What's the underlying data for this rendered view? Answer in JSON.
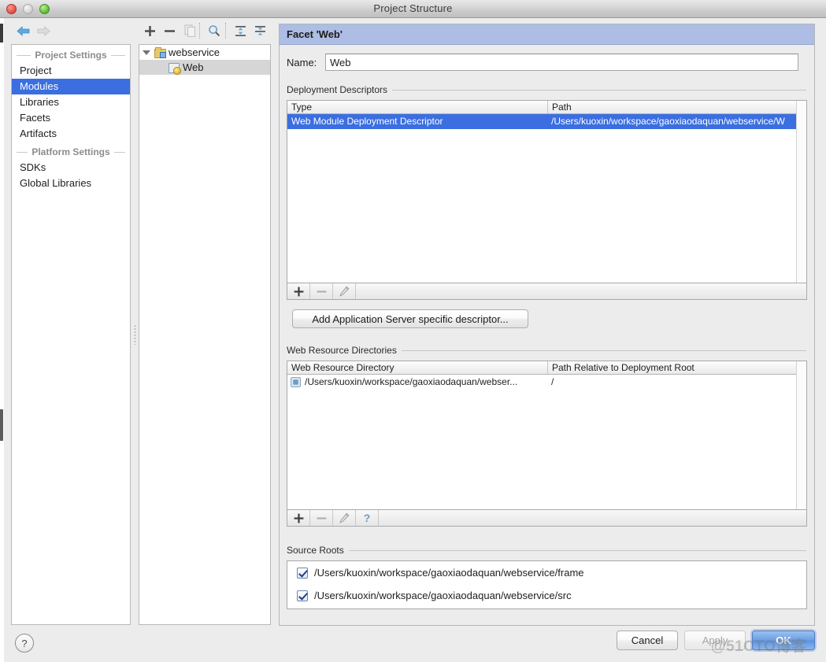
{
  "window": {
    "title": "Project Structure",
    "controls": [
      "close",
      "minimize",
      "zoom"
    ]
  },
  "toolbar": {
    "back_icon": "arrow-left-icon",
    "forward_icon": "arrow-right-icon",
    "add_label": "+",
    "remove_label": "−",
    "copy_icon": "copy-icon",
    "find_icon": "search-icon",
    "expand_all_icon": "expand-all-icon",
    "collapse_all_icon": "collapse-all-icon"
  },
  "sidebar": {
    "groups": [
      {
        "title": "Project Settings",
        "items": [
          {
            "label": "Project",
            "selected": false
          },
          {
            "label": "Modules",
            "selected": true
          },
          {
            "label": "Libraries",
            "selected": false
          },
          {
            "label": "Facets",
            "selected": false
          },
          {
            "label": "Artifacts",
            "selected": false
          }
        ]
      },
      {
        "title": "Platform Settings",
        "items": [
          {
            "label": "SDKs",
            "selected": false
          },
          {
            "label": "Global Libraries",
            "selected": false
          }
        ]
      }
    ]
  },
  "tree": {
    "items": [
      {
        "label": "webservice",
        "icon": "module-folder-icon",
        "level": 0,
        "expanded": true,
        "selected": false
      },
      {
        "label": "Web",
        "icon": "web-facet-icon",
        "level": 1,
        "expanded": false,
        "selected": true
      }
    ]
  },
  "detail": {
    "facet_title": "Facet 'Web'",
    "name": {
      "label": "Name:",
      "value": "Web",
      "placeholder": ""
    },
    "deployment_descriptors": {
      "section_title": "Deployment Descriptors",
      "columns": [
        "Type",
        "Path"
      ],
      "rows": [
        {
          "type": "Web Module Deployment Descriptor",
          "path": "/Users/kuoxin/workspace/gaoxiaodaquan/webservice/W",
          "selected": true
        }
      ],
      "toolbar": [
        "+",
        "−",
        "edit-icon"
      ],
      "add_server_descriptor_label": "Add Application Server specific descriptor..."
    },
    "web_resource_directories": {
      "section_title": "Web Resource Directories",
      "columns": [
        "Web Resource Directory",
        "Path Relative to Deployment Root"
      ],
      "rows": [
        {
          "directory": "/Users/kuoxin/workspace/gaoxiaodaquan/webser...",
          "relative_path": "/",
          "icon": "web-resource-folder-icon"
        }
      ],
      "toolbar": [
        "+",
        "−",
        "edit-icon",
        "?"
      ]
    },
    "source_roots": {
      "section_title": "Source Roots",
      "rows": [
        {
          "label": "/Users/kuoxin/workspace/gaoxiaodaquan/webservice/frame",
          "checked": true
        },
        {
          "label": "/Users/kuoxin/workspace/gaoxiaodaquan/webservice/src",
          "checked": true
        }
      ]
    }
  },
  "footer": {
    "help_label": "?",
    "cancel_label": "Cancel",
    "apply_label": "Apply",
    "ok_label": "OK",
    "watermark": "@51CTO博客"
  },
  "colors": {
    "selection_blue": "#3b6ee0",
    "facet_header_blue": "#adbde4",
    "window_chrome": "#ececec",
    "ok_button_blue": "#6d9fe4"
  }
}
